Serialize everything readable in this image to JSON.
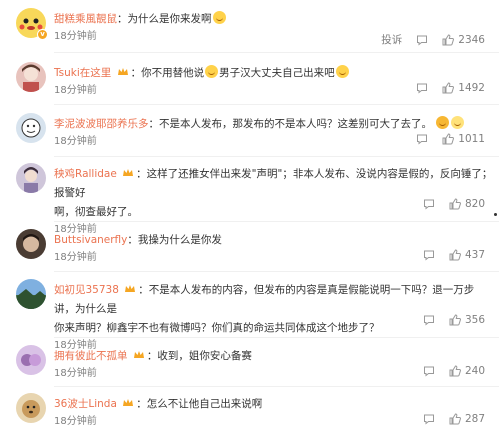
{
  "comments": [
    {
      "username": "甜糕乘風靚鼠",
      "text": "：为什么是你来发啊",
      "emoji_after": true,
      "time": "18分钟前",
      "show_report": true,
      "report_label": "投诉",
      "likes": "2346",
      "avatar_color": "#f4c94a",
      "has_gold": false
    },
    {
      "username": "Tsuki在这里",
      "text": "：你不用替他说",
      "extra_text": "男子汉大丈夫自己出来吧",
      "time": "18分钟前",
      "likes": "1492",
      "avatar_color": "#d9a3a0",
      "has_gold": true
    },
    {
      "username": "李泥波波耶邵养乐多",
      "text": "：不是本人发布，那发布的不是本人吗？这差别可大了去了。",
      "time": "18分钟前",
      "likes": "1011",
      "avatar_color": "#c9d8e6",
      "has_gold": false
    },
    {
      "username": "秧鸡Rallidae",
      "text": "：这样了还推女伴出来发\"声明\"；非本人发布、没说内容是假的，反向锤了；报警好",
      "text2": "啊，彻查最好了。",
      "time": "18分钟前",
      "likes": "820",
      "avatar_color": "#b9b2c9",
      "has_gold": true
    },
    {
      "username": "Buttsivanerfly",
      "text": "：我操为什么是你发",
      "time": "18分钟前",
      "likes": "437",
      "avatar_color": "#6b5a4e",
      "has_gold": false
    },
    {
      "username": "如初见35738",
      "text": "：不是本人发布的内容，但发布的内容是真是假能说明一下吗？退一万步讲，为什么是",
      "text2": "你来声明？柳鑫宇不也有微博吗？你们真的命运共同体成这个地步了？",
      "time": "18分钟前",
      "likes": "356",
      "avatar_color": "#4f7fb8",
      "has_gold": true
    },
    {
      "username": "拥有彼此不孤单",
      "text": "：收到，姐你安心备赛",
      "time": "18分钟前",
      "likes": "240",
      "avatar_color": "#b98fc9",
      "has_gold": true
    },
    {
      "username": "36波士Linda",
      "text": "：怎么不让他自己出来说啊",
      "time": "18分钟前",
      "likes": "287",
      "avatar_color": "#caa66a",
      "has_gold": true
    }
  ],
  "colors": {
    "username": "#eb7350",
    "meta": "#808080",
    "text": "#333333"
  },
  "icons": [
    "like-icon",
    "reply-icon",
    "crown-badge-icon",
    "verified-badge-icon"
  ]
}
